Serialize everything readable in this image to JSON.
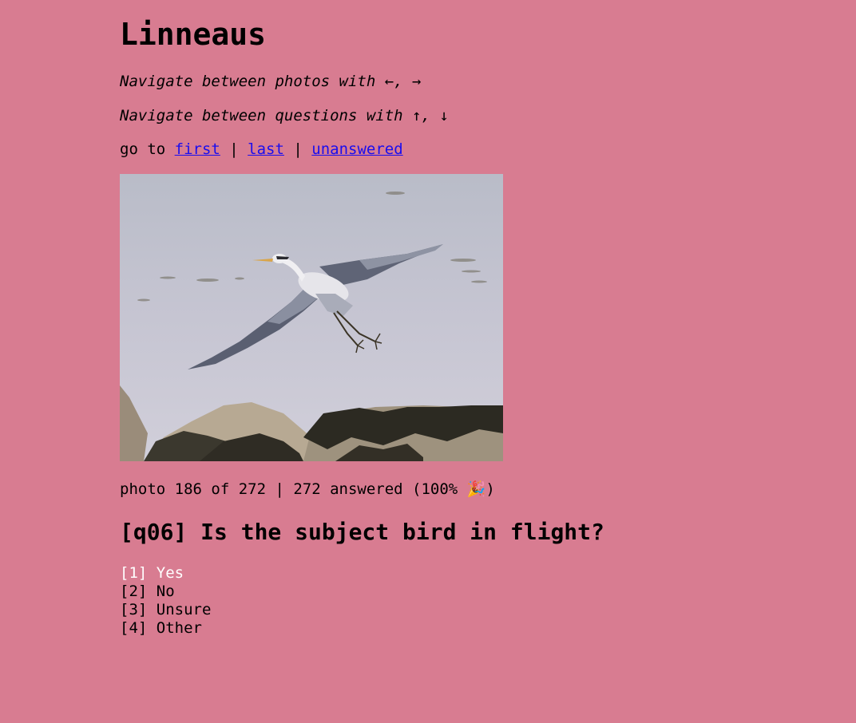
{
  "app": {
    "title": "Linneaus"
  },
  "hints": {
    "photos": "Navigate between photos with ←, →",
    "questions": "Navigate between questions with ↑, ↓"
  },
  "goto": {
    "prefix": "go to ",
    "sep": " | ",
    "first": "first",
    "last": "last",
    "unanswered": "unanswered"
  },
  "photo": {
    "subject": "heron in flight over water with rocks"
  },
  "status": {
    "text": "photo 186 of 272 | 272 answered (100% ",
    "emoji": "🎉",
    "close": ")"
  },
  "question": {
    "title": "[q06] Is the subject bird in flight?"
  },
  "options": [
    {
      "label": "[1] Yes",
      "selected": true
    },
    {
      "label": "[2] No",
      "selected": false
    },
    {
      "label": "[3] Unsure",
      "selected": false
    },
    {
      "label": "[4] Other",
      "selected": false
    }
  ],
  "colors": {
    "background": "#d87c91",
    "link": "#1a0dee",
    "selected_option": "#ffffff"
  },
  "icons": {
    "celebration": "party-popper-icon"
  }
}
